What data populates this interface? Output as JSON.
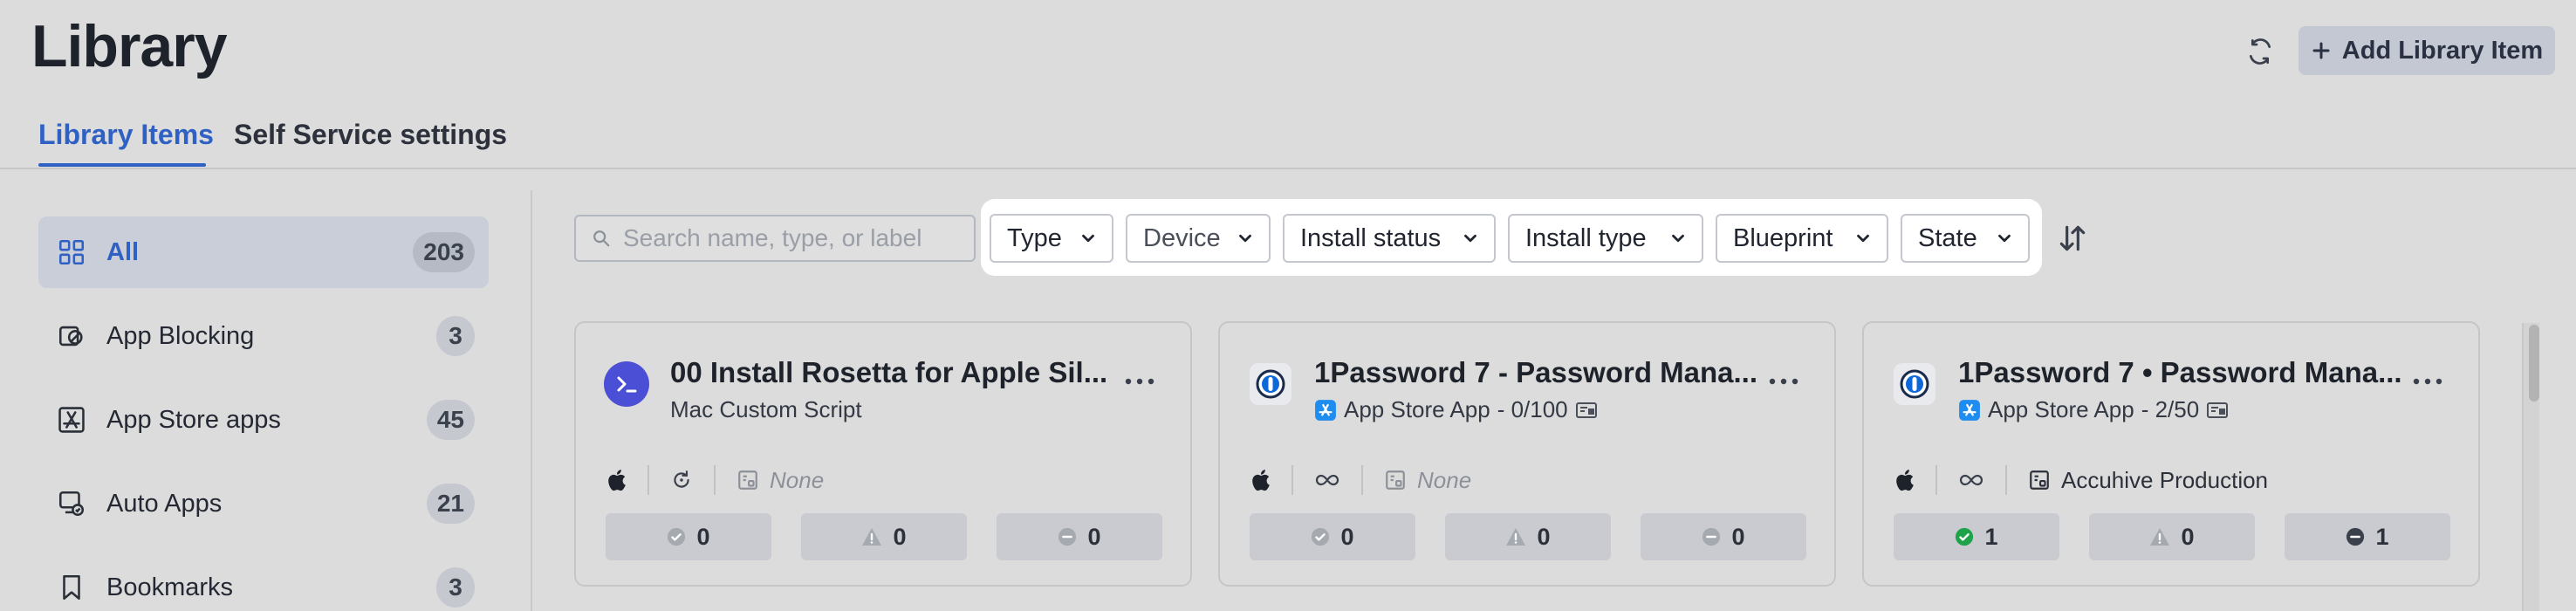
{
  "header": {
    "title": "Library",
    "add_button_label": "Add Library Item"
  },
  "tabs": [
    {
      "label": "Library Items",
      "active": true
    },
    {
      "label": "Self Service settings",
      "active": false
    }
  ],
  "sidebar": {
    "items": [
      {
        "label": "All",
        "count": "203",
        "icon": "grid-icon",
        "active": true
      },
      {
        "label": "App Blocking",
        "count": "3",
        "icon": "app-blocking-icon"
      },
      {
        "label": "App Store apps",
        "count": "45",
        "icon": "app-store-icon"
      },
      {
        "label": "Auto Apps",
        "count": "21",
        "icon": "auto-apps-icon"
      },
      {
        "label": "Bookmarks",
        "count": "3",
        "icon": "bookmark-icon"
      }
    ]
  },
  "search": {
    "placeholder": "Search name, type, or label",
    "value": ""
  },
  "filters": [
    "Type",
    "Device",
    "Install status",
    "Install type",
    "Blueprint",
    "State"
  ],
  "cards": [
    {
      "title": "00 Install Rosetta for Apple Sil...",
      "subtitle": "Mac Custom Script",
      "subtitle_extra": "",
      "icon": "terminal-icon",
      "platform": "apple-icon",
      "frequency": "refresh-icon",
      "blueprint": "None",
      "blueprint_none": true,
      "stats": {
        "success": "0",
        "warning": "0",
        "excluded": "0"
      }
    },
    {
      "title": "1Password 7 - Password Mana...",
      "subtitle": "App Store App",
      "subtitle_extra": "- 0/100",
      "icon": "onepassword-icon",
      "platform": "apple-icon",
      "frequency": "infinity-icon",
      "blueprint": "None",
      "blueprint_none": true,
      "stats": {
        "success": "0",
        "warning": "0",
        "excluded": "0"
      }
    },
    {
      "title": "1Password 7 • Password Mana...",
      "subtitle": "App Store App",
      "subtitle_extra": "- 2/50",
      "icon": "onepassword-icon",
      "platform": "apple-icon",
      "frequency": "infinity-icon",
      "blueprint": "Accuhive Production",
      "blueprint_none": false,
      "stats": {
        "success": "1",
        "warning": "0",
        "excluded": "1"
      }
    }
  ],
  "colors": {
    "accent": "#2f60c4",
    "success": "#1fa34a",
    "excluded": "#3b414c",
    "script_icon": "#4a4fd6"
  }
}
